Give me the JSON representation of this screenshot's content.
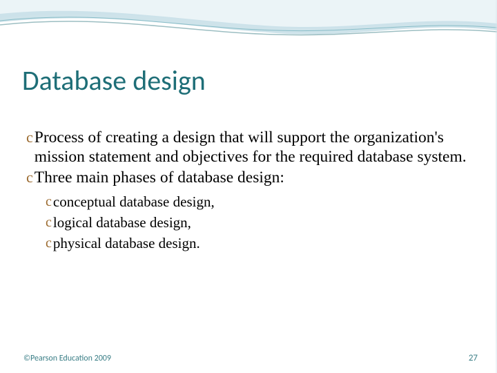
{
  "title": "Database design",
  "bullets": [
    {
      "text": "Process of creating a design that will support the organization's mission statement and objectives for the required database system."
    },
    {
      "text": "Three main phases of database design:"
    }
  ],
  "sub_bullets": [
    {
      "text": "conceptual database design,"
    },
    {
      "text": "logical database design,"
    },
    {
      "text": "physical database design."
    }
  ],
  "footer": {
    "copyright": "©Pearson Education 2009",
    "page_number": "27"
  },
  "bullet_glyph": "c"
}
